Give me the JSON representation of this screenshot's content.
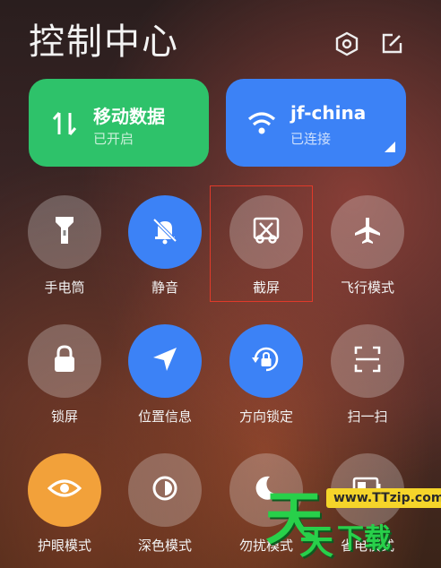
{
  "header": {
    "title": "控制中心"
  },
  "tiles": {
    "mobile_data": {
      "title": "移动数据",
      "status": "已开启",
      "color": "#2ec26a"
    },
    "wifi": {
      "title": "jf-china",
      "status": "已连接",
      "color": "#3c82f6"
    }
  },
  "toggles": [
    {
      "label": "手电筒",
      "icon": "flashlight-icon",
      "state": "off"
    },
    {
      "label": "静音",
      "icon": "bell-off-icon",
      "state": "on"
    },
    {
      "label": "截屏",
      "icon": "scissors-screenshot-icon",
      "state": "off"
    },
    {
      "label": "飞行模式",
      "icon": "airplane-icon",
      "state": "off"
    },
    {
      "label": "锁屏",
      "icon": "lock-icon",
      "state": "off"
    },
    {
      "label": "位置信息",
      "icon": "location-arrow-icon",
      "state": "on"
    },
    {
      "label": "方向锁定",
      "icon": "rotation-lock-icon",
      "state": "on"
    },
    {
      "label": "扫一扫",
      "icon": "scan-icon",
      "state": "off"
    },
    {
      "label": "护眼模式",
      "icon": "eye-icon",
      "state": "on"
    },
    {
      "label": "深色模式",
      "icon": "dark-mode-icon",
      "state": "off"
    },
    {
      "label": "勿扰模式",
      "icon": "moon-icon",
      "state": "off"
    },
    {
      "label": "省电模式",
      "icon": "battery-icon",
      "state": "off"
    }
  ],
  "watermark": {
    "logo_char_1": "天",
    "logo_char_2": "天",
    "url": "www.TTzip.com",
    "text": "下载"
  }
}
